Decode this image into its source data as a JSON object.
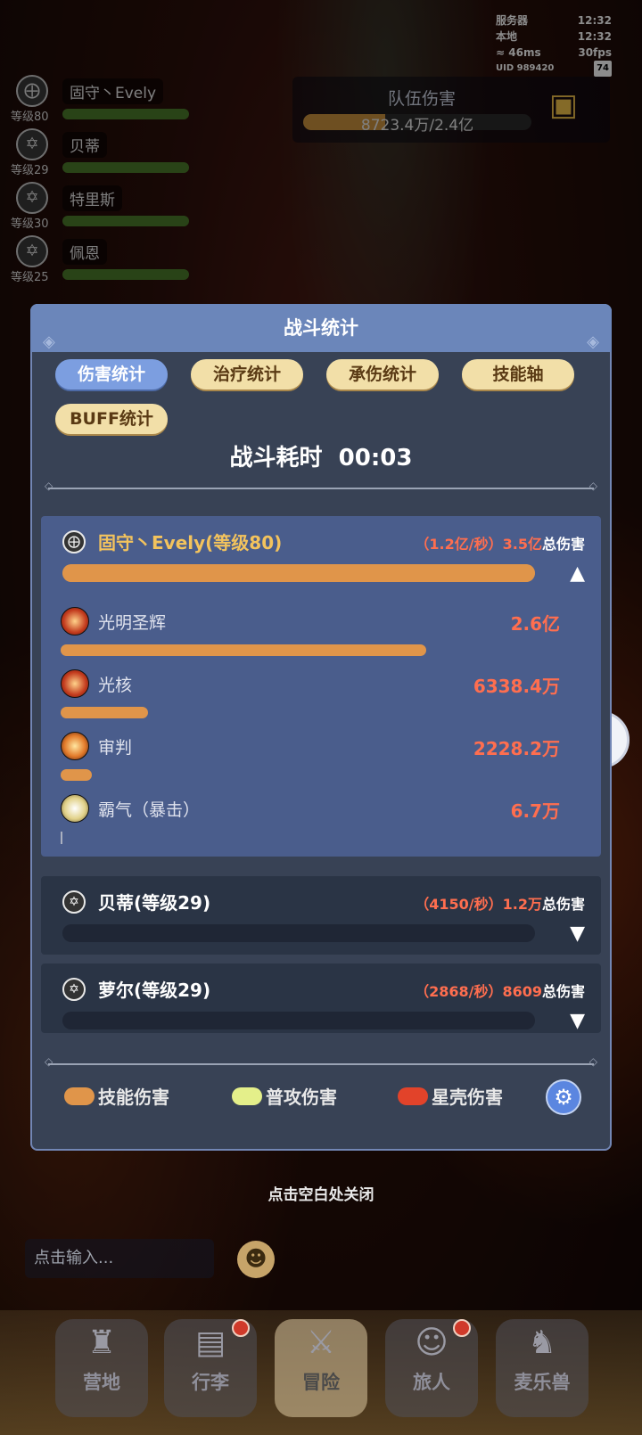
{
  "status": {
    "server_label": "服务器",
    "server_time": "12:32",
    "local_label": "本地",
    "local_time": "12:32",
    "ping": "46ms",
    "fps": "30fps",
    "uid_label": "UID",
    "uid": "989420",
    "battery": "74"
  },
  "party": [
    {
      "name": "固守丶Evely",
      "level": "等级80",
      "icon": "shield-cross-icon"
    },
    {
      "name": "贝蒂",
      "level": "等级29",
      "icon": "star-hex-icon"
    },
    {
      "name": "特里斯",
      "level": "等级30",
      "icon": "star-hex-icon"
    },
    {
      "name": "佩恩",
      "level": "等级25",
      "icon": "star-hex-icon"
    }
  ],
  "team_damage": {
    "title": "队伍伤害",
    "value": "8723.4万/2.4亿",
    "progress": 0.36
  },
  "modal": {
    "title": "战斗统计",
    "tabs": [
      "伤害统计",
      "治疗统计",
      "承伤统计",
      "技能轴",
      "BUFF统计"
    ],
    "active_tab": "伤害统计",
    "duration_label": "战斗耗时",
    "duration": "00:03",
    "players": [
      {
        "name": "固守丶Evely(等级80)",
        "rate": "（1.2亿/秒）",
        "total": "3.5亿",
        "total_label": "总伤害",
        "bar": 1.0,
        "expanded": true,
        "skills": [
          {
            "name": "光明圣辉",
            "value": "2.6亿",
            "bar": 0.75
          },
          {
            "name": "光核",
            "value": "6338.4万",
            "bar": 0.18
          },
          {
            "name": "审判",
            "value": "2228.2万",
            "bar": 0.065
          },
          {
            "name": "霸气（暴击）",
            "value": "6.7万",
            "bar": 0.0
          }
        ]
      },
      {
        "name": "贝蒂(等级29)",
        "rate": "（4150/秒）",
        "total": "1.2万",
        "total_label": "总伤害",
        "bar": 0.0,
        "expanded": false
      },
      {
        "name": "萝尔(等级29)",
        "rate": "（2868/秒）",
        "total": "8609",
        "total_label": "总伤害",
        "bar": 0.0,
        "expanded": false
      }
    ],
    "legend": [
      {
        "label": "技能伤害",
        "color": "#e0954a"
      },
      {
        "label": "普攻伤害",
        "color": "#e4ef8a"
      },
      {
        "label": "星壳伤害",
        "color": "#e2432a"
      }
    ]
  },
  "close_hint": "点击空白处关闭",
  "chat_input": {
    "placeholder": "点击输入..."
  },
  "bottom_nav": [
    {
      "label": "营地",
      "icon": "castle-icon",
      "badge": false
    },
    {
      "label": "行李",
      "icon": "chest-icon",
      "badge": true
    },
    {
      "label": "冒险",
      "icon": "crossed-swords-icon",
      "badge": false
    },
    {
      "label": "旅人",
      "icon": "traveler-icon",
      "badge": true
    },
    {
      "label": "麦乐兽",
      "icon": "beast-icon",
      "badge": false
    }
  ]
}
